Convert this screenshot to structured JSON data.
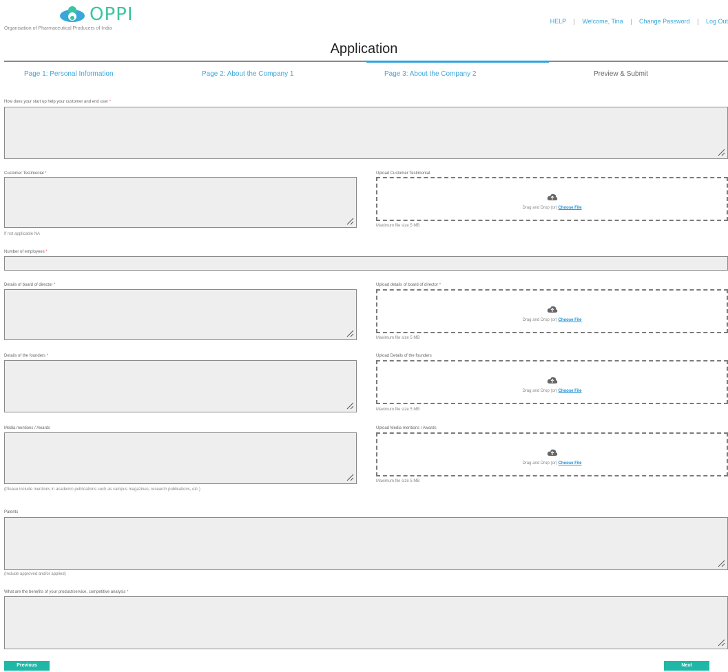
{
  "header": {
    "logo_text": "OPPI",
    "tagline": "Organisation of Pharmaceutical Producers of India",
    "links": [
      "HELP",
      "Welcome, Tina",
      "Change Password",
      "Log Out"
    ],
    "separator": "|"
  },
  "page_title": "Application",
  "tabs": [
    {
      "label": "Page 1: Personal Information"
    },
    {
      "label": "Page 2: About the Company 1"
    },
    {
      "label": "Page 3: About the Company 2"
    },
    {
      "label": "Preview & Submit"
    }
  ],
  "form": {
    "q_help_customer": {
      "label": "How does your start up help your customer and end user",
      "required": "*"
    },
    "customer_testimonial": {
      "label": "Customer Testimonial",
      "required": "*",
      "hint": "If not applicable NA"
    },
    "upload_customer_testimonial": {
      "label": "Upload Customer Testimonial",
      "hint": "Maximum file size 5 MB"
    },
    "num_employees": {
      "label": "Number of employees",
      "required": "*"
    },
    "board_directors": {
      "label": "Details of board of director",
      "required": "*"
    },
    "upload_board_directors": {
      "label": "Upload details of board of director",
      "required": "*",
      "hint": "Maximum file size 5 MB"
    },
    "founders": {
      "label": "Details of the founders",
      "required": "*"
    },
    "upload_founders": {
      "label": "Upload Details of the founders",
      "hint": "Maximum file size 5 MB"
    },
    "media_mentions": {
      "label": "Media mentions / Awards",
      "hint": "(Please include mentions in academic publications such as campus magazines, research publications, etc.)"
    },
    "upload_media_mentions": {
      "label": "Upload Media mentions / Awards",
      "hint": "Maximum file size 5 MB"
    },
    "patents": {
      "label": "Patents",
      "hint": "(Include approved and/or applied)"
    },
    "benefits": {
      "label": "What are the benefits of your product/service, competitive analysis",
      "required": "*"
    }
  },
  "dropzone": {
    "text": "Drag and Drop (or)",
    "link": "Choose File"
  },
  "buttons": {
    "previous": "Previous",
    "next": "Next"
  },
  "colors": {
    "brand": "#3cc4a0",
    "link": "#3aa7d9",
    "button": "#1fb8a6",
    "active_tab_rule": "#29a3e0"
  },
  "icons": {
    "logo": "oppi-logo-icon",
    "upload": "cloud-upload-icon",
    "resize": "resize-grip-icon"
  }
}
